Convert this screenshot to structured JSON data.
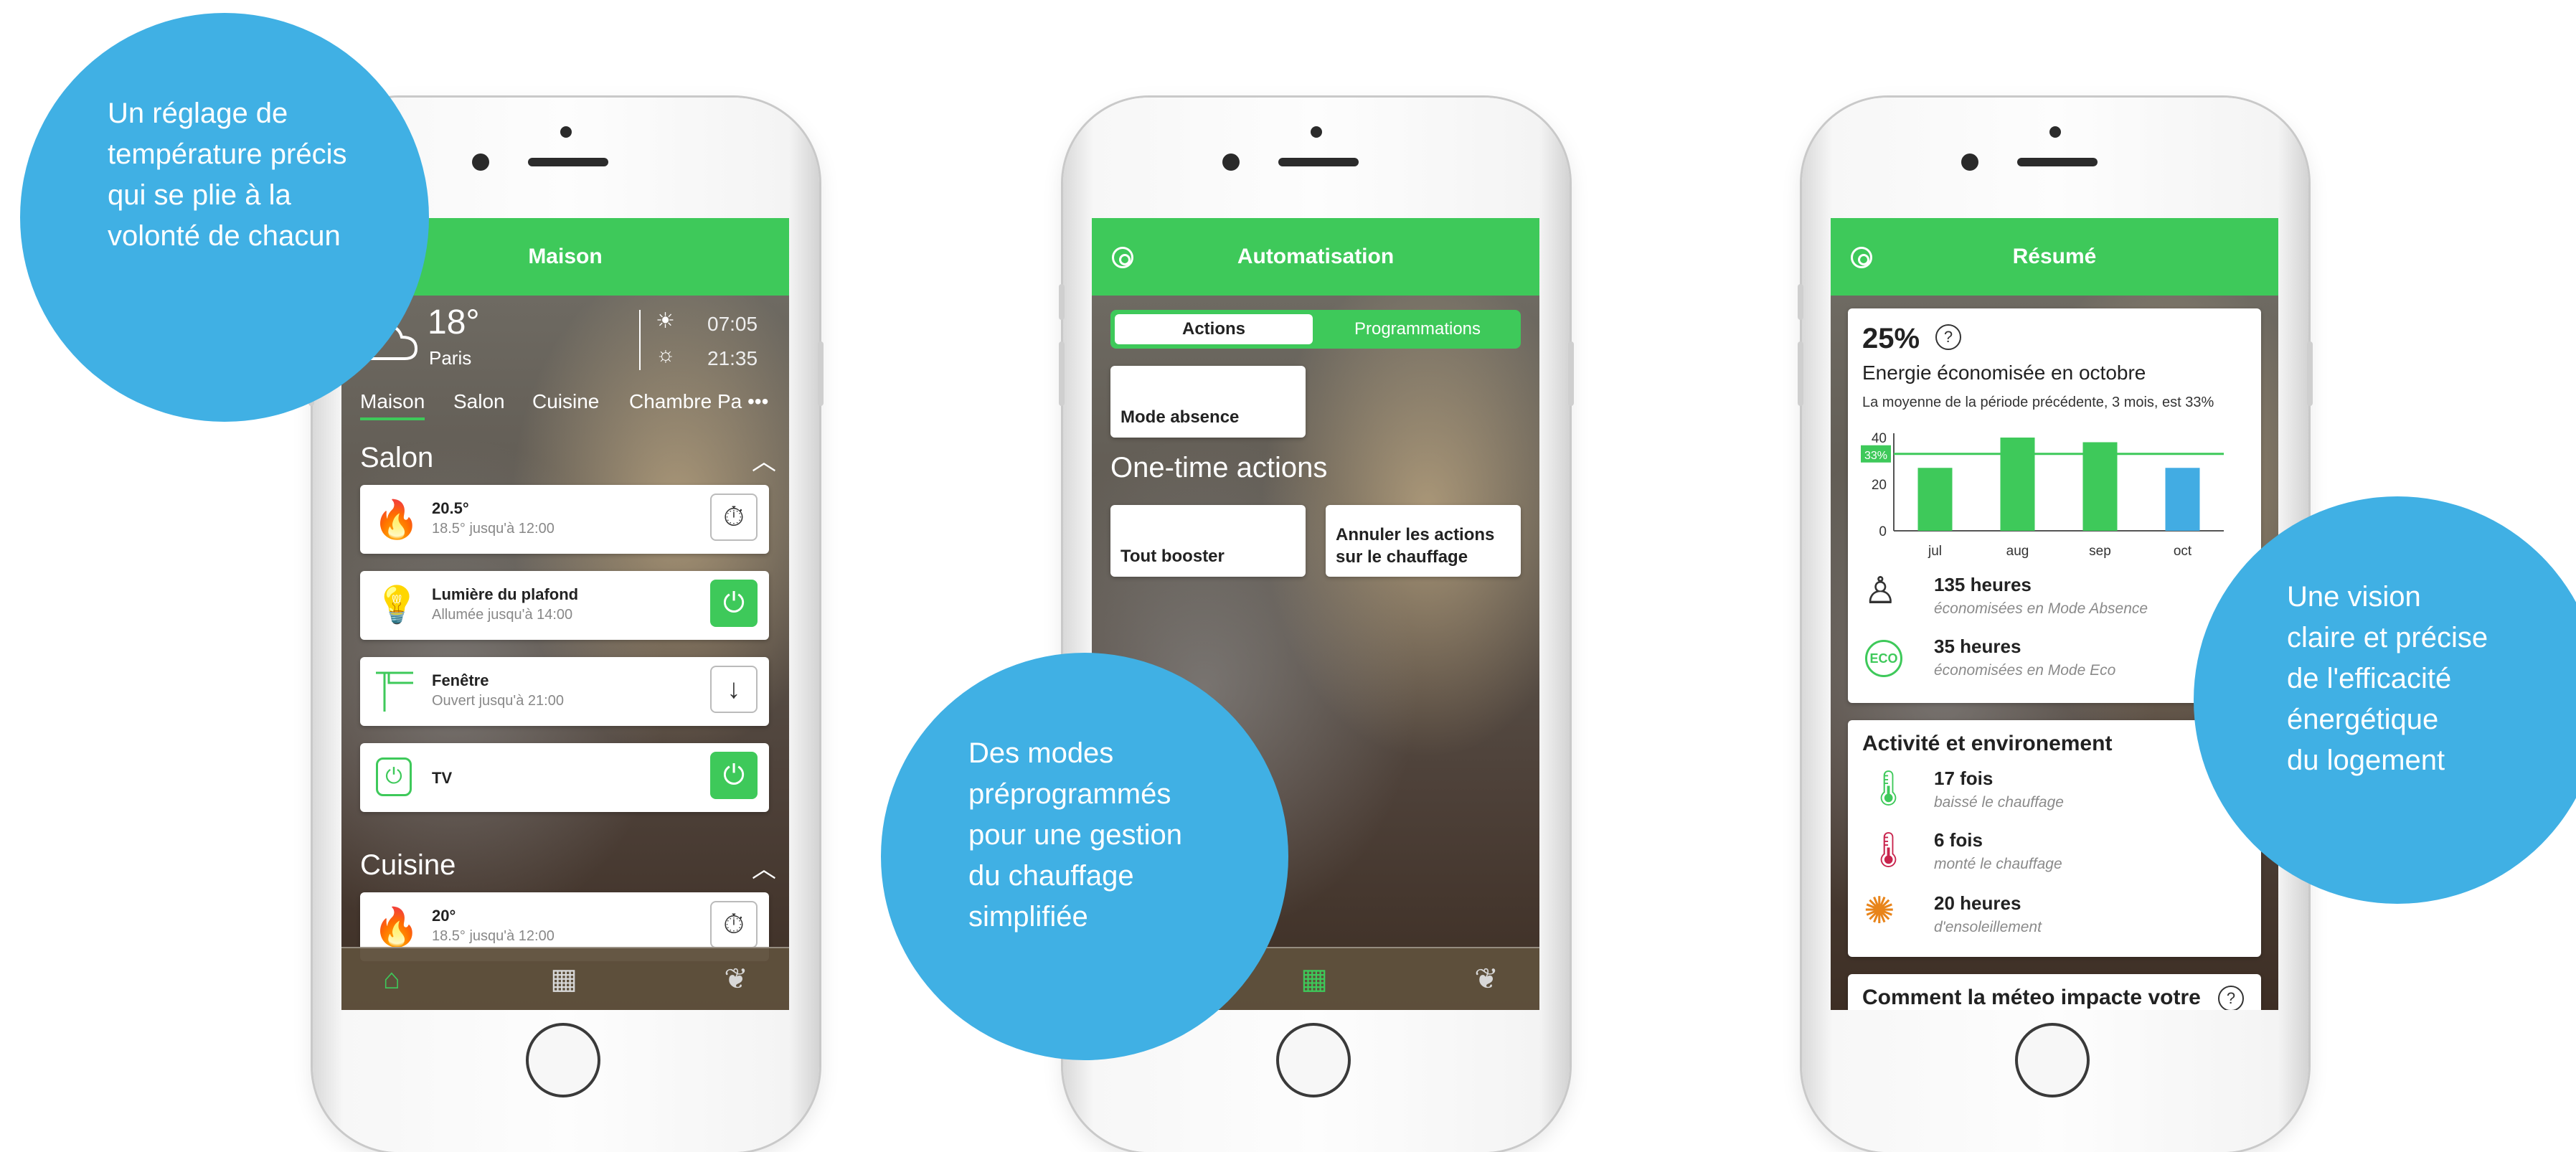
{
  "bubbles": {
    "left": [
      "Un réglage de",
      "température précis",
      "qui se plie à la",
      "volonté de chacun"
    ],
    "middle": [
      "Des modes",
      "préprogrammés",
      "pour une gestion",
      "du chauffage",
      "simplifiée"
    ],
    "right": [
      "Une vision",
      "claire et précise",
      "de l'efficacité",
      "énergétique",
      "du logement"
    ]
  },
  "phone1": {
    "title": "Maison",
    "weather": {
      "temp": "18°",
      "city": "Paris",
      "sunrise": "07:05",
      "sunset": "21:35"
    },
    "rooms": [
      "Maison",
      "Salon",
      "Cuisine",
      "Chambre Pa"
    ],
    "more": "•••",
    "sections": [
      {
        "title": "Salon",
        "devices": [
          {
            "name": "20.5°",
            "sub": "18.5° jusqu'à 12:00",
            "icon": "flame-icon",
            "action": "timer-icon"
          },
          {
            "name": "Lumière du plafond",
            "sub": "Allumée jusqu'à 14:00",
            "icon": "bulb-icon",
            "action": "power-icon"
          },
          {
            "name": "Fenêtre",
            "sub": "Ouvert jusqu'à 21:00",
            "icon": "window-icon",
            "action": "arrow-down-icon"
          },
          {
            "name": "TV",
            "sub": "",
            "icon": "plug-icon",
            "action": "power-icon"
          }
        ]
      },
      {
        "title": "Cuisine",
        "devices": [
          {
            "name": "20°",
            "sub": "18.5° jusqu'à 12:00",
            "icon": "flame-icon",
            "action": "timer-icon"
          }
        ]
      }
    ]
  },
  "phone2": {
    "title": "Automatisation",
    "tabs": [
      "Actions",
      "Programmations"
    ],
    "mode_absence": "Mode absence",
    "section": "One-time actions",
    "tiles": [
      "Tout booster",
      "Annuler les actions",
      "sur le chauffage"
    ]
  },
  "phone3": {
    "title": "Résumé",
    "percent": "25%",
    "help": "?",
    "subtitle": "Energie économisée en octobre",
    "note": "La moyenne de la période précédente, 3 mois, est 33%",
    "avg_tag": "33%",
    "stats": [
      {
        "value": "135 heures",
        "label": "économisées en Mode Absence",
        "icon": "person-away-icon"
      },
      {
        "value": "35 heures",
        "label": "économisées en Mode Eco",
        "icon": "eco-icon",
        "badge": "ECO"
      }
    ],
    "activity_title": "Activité et environement",
    "activity": [
      {
        "value": "17 fois",
        "label": "baissé le chauffage",
        "icon": "thermo-down-icon"
      },
      {
        "value": "6 fois",
        "label": "monté le chauffage",
        "icon": "thermo-up-icon"
      },
      {
        "value": "20 heures",
        "label": "d'ensoleillement",
        "icon": "sun-icon"
      }
    ],
    "weather_card": "Comment la méteo impacte votre"
  },
  "chart_data": {
    "type": "bar",
    "categories": [
      "jul",
      "aug",
      "sep",
      "oct"
    ],
    "values": [
      27,
      40,
      38,
      27
    ],
    "colors": [
      "#3ec95a",
      "#3ec95a",
      "#3ec95a",
      "#42ace3"
    ],
    "reference_line": 33,
    "ylim": [
      0,
      40
    ],
    "yticks": [
      0,
      20,
      40
    ],
    "title": "",
    "xlabel": "",
    "ylabel": ""
  },
  "colors": {
    "green": "#3ec95a",
    "blue": "#40b0e4",
    "orange": "#e8841a",
    "red": "#c8244d"
  }
}
